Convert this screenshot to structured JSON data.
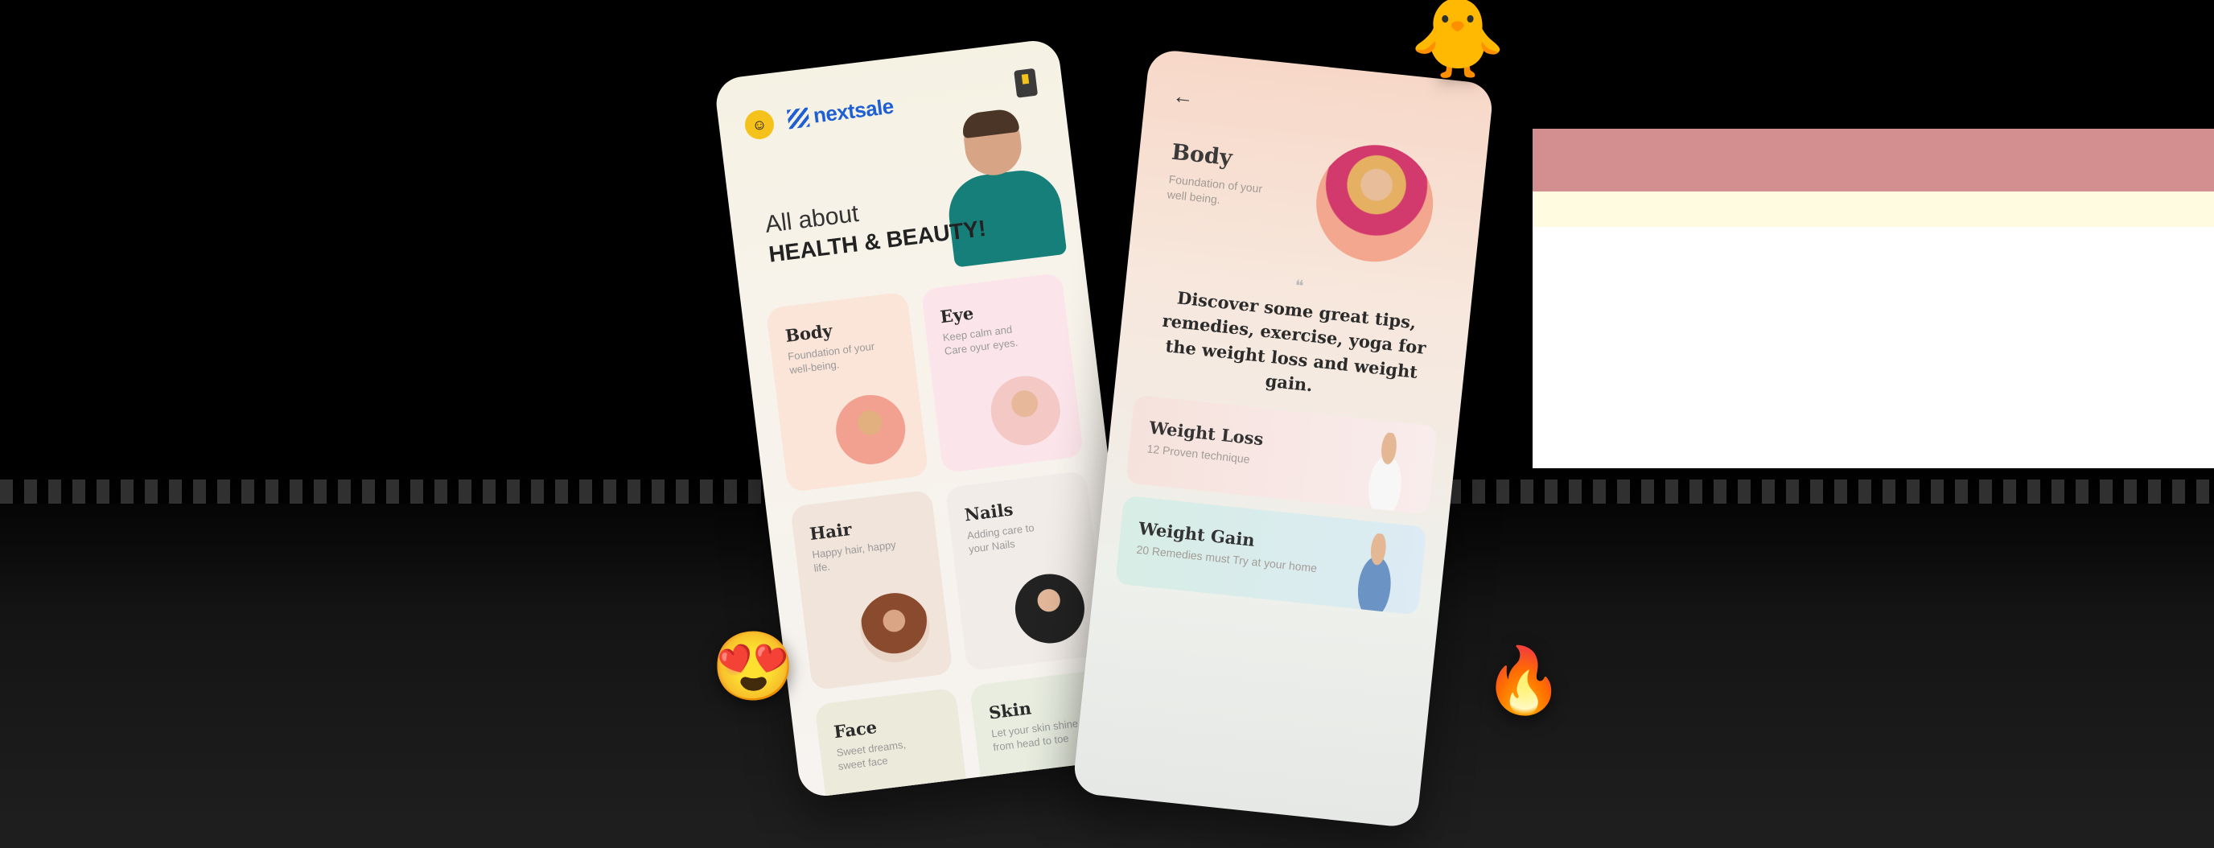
{
  "left_screen": {
    "brand": "nextsale",
    "avatar_icon": "avatar",
    "hero_line1": "All about",
    "hero_line2": "HEALTH & BEAUTY!",
    "categories": [
      {
        "title": "Body",
        "subtitle": "Foundation of your well-being."
      },
      {
        "title": "Eye",
        "subtitle": "Keep calm and Care oyur eyes."
      },
      {
        "title": "Hair",
        "subtitle": "Happy hair, happy life."
      },
      {
        "title": "Nails",
        "subtitle": "Adding care to your Nails"
      },
      {
        "title": "Face",
        "subtitle": "Sweet dreams, sweet face"
      },
      {
        "title": "Skin",
        "subtitle": "Let your skin shine from head to toe"
      }
    ]
  },
  "right_screen": {
    "back_arrow": "←",
    "title": "Body",
    "subtitle": "Foundation of your well being.",
    "quote": "Discover some great tips, remedies, exercise, yoga for the weight loss and weight gain.",
    "items": [
      {
        "title": "Weight Loss",
        "subtitle": "12 Proven technique"
      },
      {
        "title": "Weight Gain",
        "subtitle": "20 Remedies must Try at your home"
      }
    ]
  },
  "decor": {
    "emoji_love": "😍",
    "emoji_fire": "🔥",
    "emoji_bird": "🐥"
  },
  "colors": {
    "brand_blue": "#1f5fd4",
    "avatar_yellow": "#f4c21a",
    "hero_shirt": "#167f7a"
  }
}
